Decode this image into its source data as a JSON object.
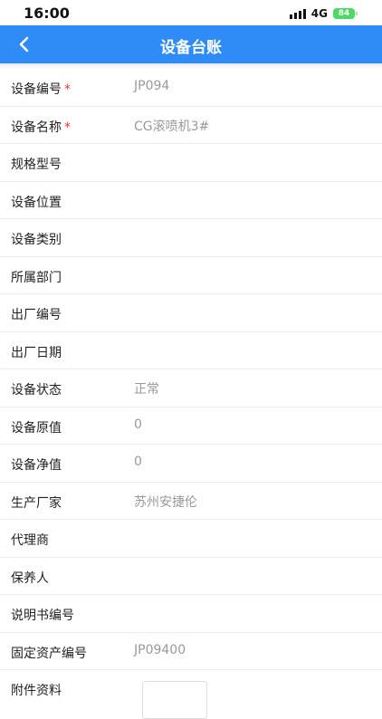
{
  "statusbar": {
    "time": "16:00",
    "network": "4G",
    "battery": "84"
  },
  "navbar": {
    "title": "设备台账"
  },
  "form": {
    "rows": [
      {
        "label": "设备编号",
        "required": true,
        "value": "JP094"
      },
      {
        "label": "设备名称",
        "required": true,
        "value": "CG滚喷机3#"
      },
      {
        "label": "规格型号",
        "required": false,
        "value": ""
      },
      {
        "label": "设备位置",
        "required": false,
        "value": ""
      },
      {
        "label": "设备类别",
        "required": false,
        "value": ""
      },
      {
        "label": "所属部门",
        "required": false,
        "value": ""
      },
      {
        "label": "出厂编号",
        "required": false,
        "value": ""
      },
      {
        "label": "出厂日期",
        "required": false,
        "value": ""
      },
      {
        "label": "设备状态",
        "required": false,
        "value": "正常"
      },
      {
        "label": "设备原值",
        "required": false,
        "value": "0"
      },
      {
        "label": "设备净值",
        "required": false,
        "value": "0"
      },
      {
        "label": "生产厂家",
        "required": false,
        "value": "苏州安捷伦"
      },
      {
        "label": "代理商",
        "required": false,
        "value": ""
      },
      {
        "label": "保养人",
        "required": false,
        "value": ""
      },
      {
        "label": "说明书编号",
        "required": false,
        "value": ""
      },
      {
        "label": "固定资产编号",
        "required": false,
        "value": "JP09400"
      },
      {
        "label": "附件资料",
        "required": false,
        "value": ""
      }
    ],
    "required_mark": "*"
  }
}
